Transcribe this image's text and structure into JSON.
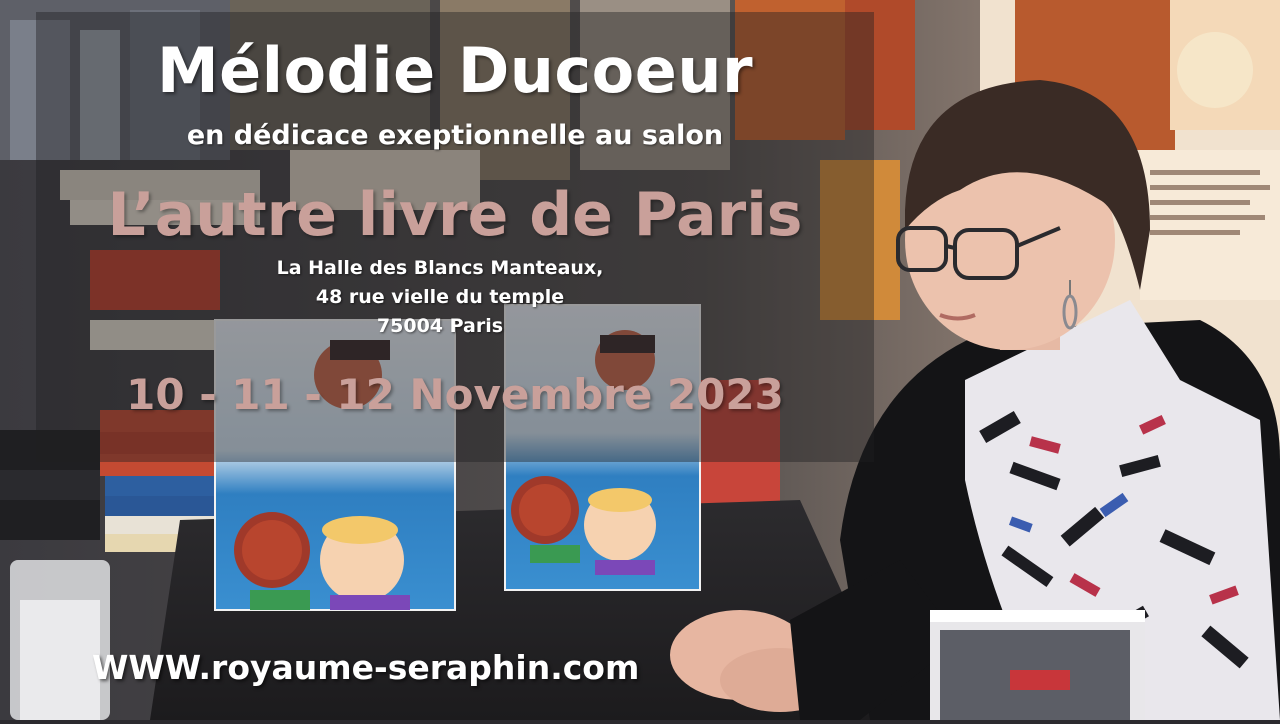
{
  "poster": {
    "author_name": "Mélodie Ducoeur",
    "subtitle": "en dédicace exeptionnelle au salon",
    "salon_name": "L’autre livre de Paris",
    "address": {
      "line1": "La Halle des Blancs Manteaux,",
      "line2": "48 rue vielle du temple",
      "line3": "75004 Paris"
    },
    "dates": "10 - 11 - 12 Novembre 2023",
    "website": "WWW.royaume-seraphin.com"
  },
  "colors": {
    "title_white": "#ffffff",
    "accent_rose": "#c9a09a",
    "overlay": "#1e1e22"
  }
}
